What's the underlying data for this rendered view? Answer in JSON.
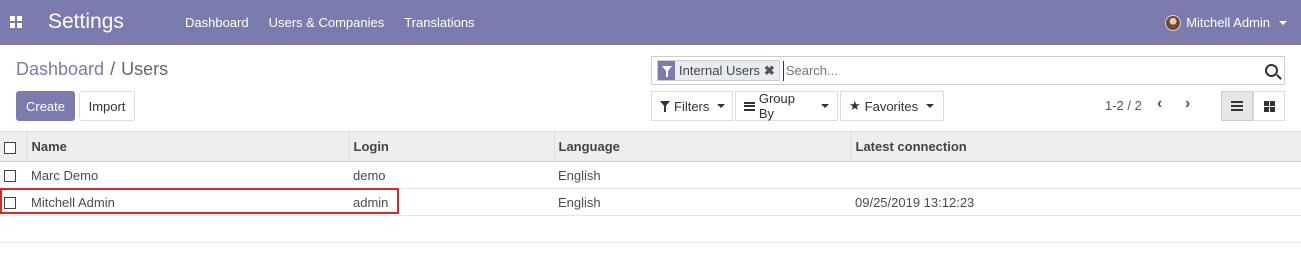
{
  "navbar": {
    "app_title": "Settings",
    "menu": [
      "Dashboard",
      "Users & Companies",
      "Translations"
    ],
    "user_name": "Mitchell Admin",
    "color": "#7c7bad"
  },
  "breadcrumb": {
    "parent": "Dashboard",
    "separator": "/",
    "current": "Users"
  },
  "buttons": {
    "create": "Create",
    "import": "Import"
  },
  "search": {
    "facet_label": "Internal Users",
    "facet_close": "✖",
    "placeholder": "Search..."
  },
  "dropdowns": {
    "filters": "Filters",
    "group_by": "Group By",
    "favorites": "Favorites"
  },
  "pager": {
    "text": "1-2 / 2",
    "prev": "‹",
    "next": "›"
  },
  "table": {
    "headers": [
      "Name",
      "Login",
      "Language",
      "Latest connection"
    ],
    "rows": [
      {
        "name": "Marc Demo",
        "login": "demo",
        "language": "English",
        "latest_connection": ""
      },
      {
        "name": "Mitchell Admin",
        "login": "admin",
        "language": "English",
        "latest_connection": "09/25/2019 13:12:23"
      }
    ]
  },
  "icons": {
    "apps": "apps-grid-icon",
    "filter": "filter-icon",
    "group_by": "bars-icon",
    "favorites": "star-icon",
    "search": "search-icon",
    "list_view": "list-view-icon",
    "kanban_view": "kanban-view-icon"
  },
  "highlight_color": "#d62a2a"
}
